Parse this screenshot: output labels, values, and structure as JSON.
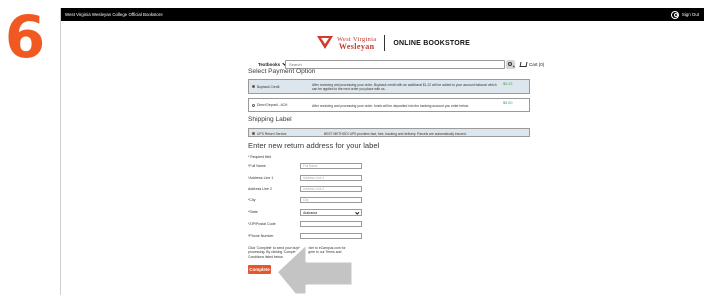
{
  "step": {
    "number": "6"
  },
  "topbar": {
    "site_title": "West Virginia Wesleyan College Official Bookstore",
    "signin_label": "Sign Out"
  },
  "header": {
    "logo_line1": "West Virginia",
    "logo_line2": "Wesleyan",
    "store_title": "ONLINE BOOKSTORE"
  },
  "navbar": {
    "textbooks_label": "Textbooks",
    "search_placeholder": "Search",
    "cart_label": "Cart (0)"
  },
  "payment": {
    "title": "Select Payment Option",
    "options": [
      {
        "name": "Buyback Credit",
        "desc": "After receiving and processing your order, Buyback credit with an additional $1.22 will be added to your account balance which can be applied to the next order you place with us.",
        "amount": "$5.22",
        "selected": true
      },
      {
        "name": "Direct Deposit - ACH",
        "desc": "After receiving and processing your order, funds will be deposited into the banking account you enter below.",
        "amount": "$5.00",
        "selected": false
      }
    ]
  },
  "shipping": {
    "title": "Shipping Label",
    "option": {
      "name": "UPS Return Service",
      "desc": "BEST METHOD! UPS provides fast, free, tracking and delivery. Parcels are automatically insured."
    }
  },
  "address": {
    "title": "Enter new return address for your label",
    "required_note": "* Required field",
    "fields": {
      "full_name": {
        "label": "*Full Name",
        "placeholder": "Full Name"
      },
      "address1": {
        "label": "*Address Line 1",
        "placeholder": "Address Line 1"
      },
      "address2": {
        "label": "Address Line 2",
        "placeholder": "Address Line 2"
      },
      "city": {
        "label": "*City",
        "placeholder": "City"
      },
      "state": {
        "label": "*State",
        "value": "Alabama"
      },
      "zip": {
        "label": "*ZIP/Postal Code",
        "placeholder": ""
      },
      "phone": {
        "label": "*Phone Number",
        "placeholder": ""
      }
    },
    "terms_text": "Click 'Complete' to send your buyback order to eCampus.com for processing. By clicking 'Complete' you agree to our Terms and Conditions listed below.",
    "complete_label": "Complete"
  },
  "colors": {
    "accent": "#e4572e",
    "step": "#f05a22",
    "selected_bg": "#dde6ec",
    "amount": "#3aa05a",
    "arrow": "#bdbdbd"
  },
  "icons": {
    "signin": "user-circle-icon",
    "search": "magnifier-icon",
    "cart": "cart-icon",
    "arrow": "arrow-pointer-icon"
  }
}
